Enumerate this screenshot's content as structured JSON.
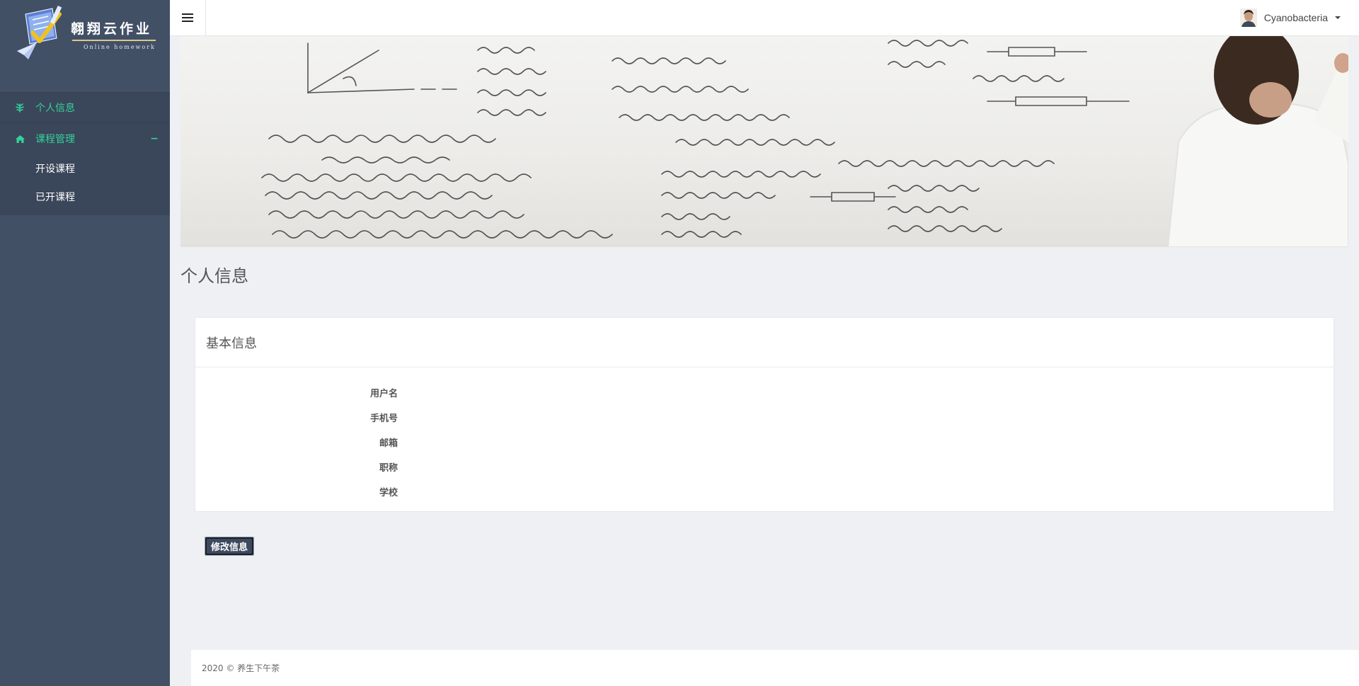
{
  "brand": {
    "title": "翱翔云作业",
    "subtitle": "Online homework"
  },
  "sidebar": {
    "items": [
      {
        "label": "个人信息",
        "icon": "leaf-icon",
        "active": true
      },
      {
        "label": "课程管理",
        "icon": "home-icon",
        "toggle": "−",
        "children": [
          {
            "label": "开设课程"
          },
          {
            "label": "已开课程"
          }
        ]
      }
    ]
  },
  "topbar": {
    "menu_icon": "hamburger-icon",
    "user_name": "Cyanobacteria"
  },
  "page": {
    "title": "个人信息"
  },
  "profile_card": {
    "header": "基本信息",
    "fields": [
      {
        "label": "用户名",
        "value": ""
      },
      {
        "label": "手机号",
        "value": ""
      },
      {
        "label": "邮箱",
        "value": ""
      },
      {
        "label": "职称",
        "value": ""
      },
      {
        "label": "学校",
        "value": ""
      }
    ]
  },
  "actions": {
    "edit_label": "修改信息"
  },
  "footer": {
    "text": "2020 © 养生下午茶"
  },
  "colors": {
    "sidebar_bg": "#425066",
    "accent": "#34d19a",
    "page_bg": "#eef0f4",
    "button_bg": "#3d4a5e"
  }
}
